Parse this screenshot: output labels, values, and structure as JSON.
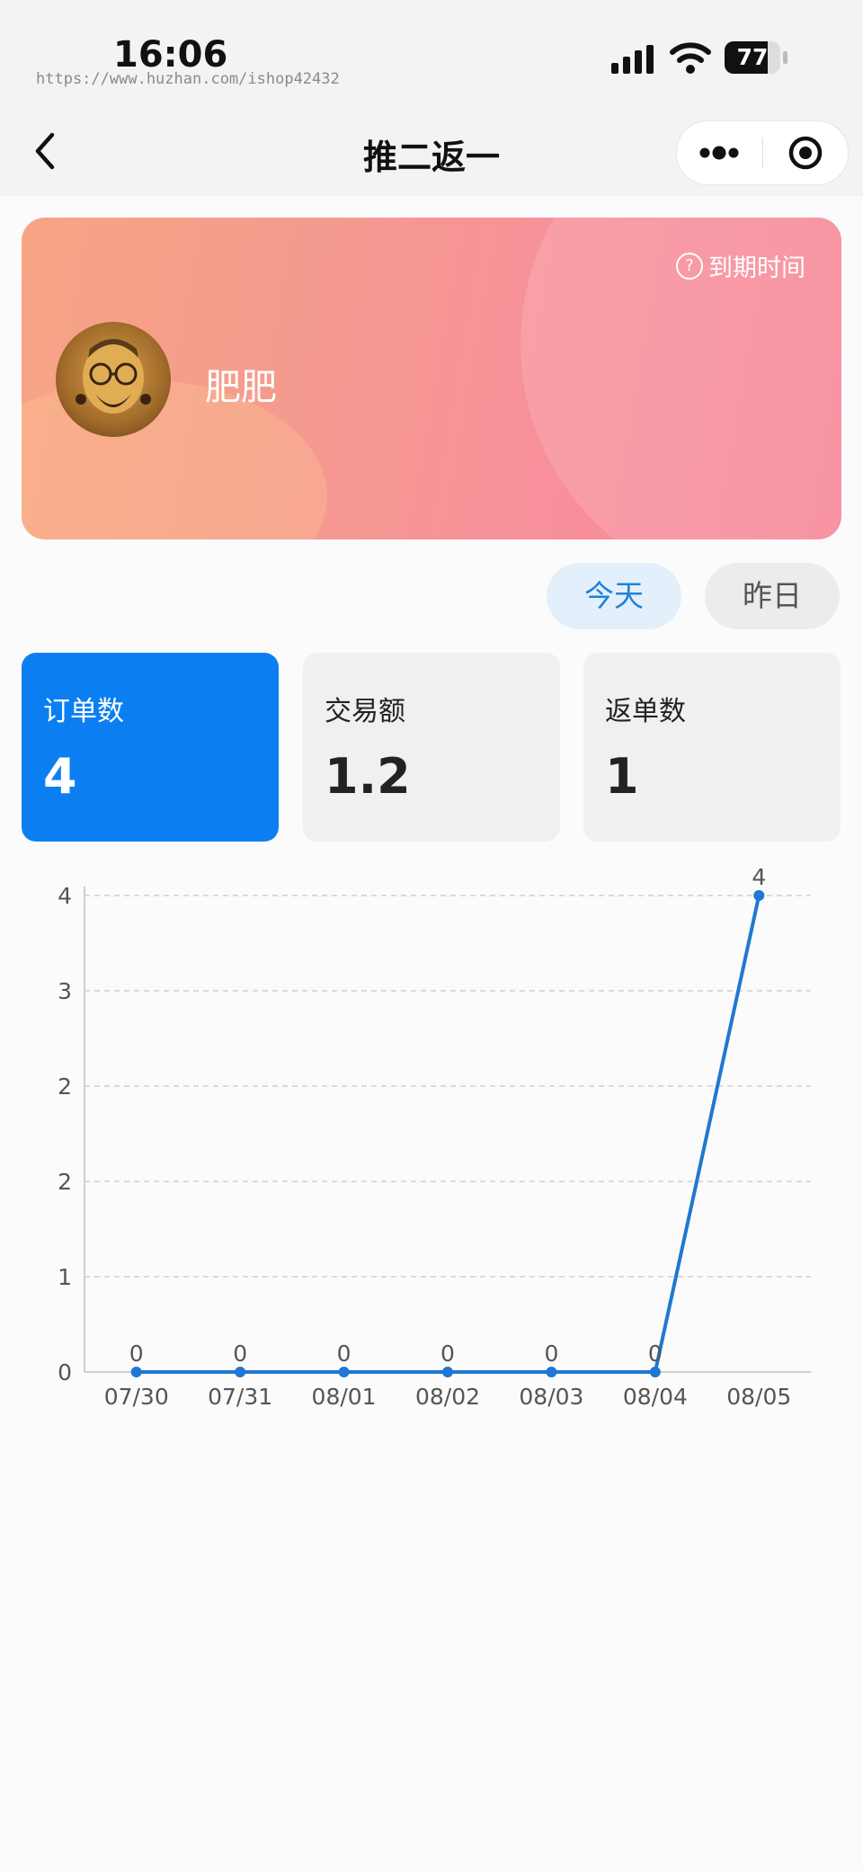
{
  "status_bar": {
    "time": "16:06",
    "watermark": "https://www.huzhan.com/ishop42432",
    "battery_level": "77",
    "battery_fraction": 0.77,
    "icons": [
      "signal-icon",
      "wifi-icon",
      "battery-icon"
    ]
  },
  "nav": {
    "title": "推二返一",
    "icons": [
      "back-icon",
      "more-icon",
      "close-mini-icon"
    ]
  },
  "profile": {
    "expiry_label": "到期时间",
    "user_name": "肥肥",
    "icons": [
      "help-icon",
      "avatar"
    ]
  },
  "date_tabs": [
    {
      "label": "今天",
      "active": true
    },
    {
      "label": "昨日",
      "active": false
    }
  ],
  "stats": [
    {
      "label": "订单数",
      "value": "4",
      "active": true
    },
    {
      "label": "交易额",
      "value": "1.2",
      "active": false
    },
    {
      "label": "返单数",
      "value": "1",
      "active": false
    }
  ],
  "colors": {
    "accent": "#0b7ff2",
    "line": "#1f78d1",
    "tab_active_text": "#1f83d8",
    "tab_active_bg": "#e3f0fb"
  },
  "chart_data": {
    "type": "line",
    "categories": [
      "07/30",
      "07/31",
      "08/01",
      "08/02",
      "08/03",
      "08/04",
      "08/05"
    ],
    "values": [
      0,
      0,
      0,
      0,
      0,
      0,
      4
    ],
    "data_labels": [
      "0",
      "0",
      "0",
      "0",
      "0",
      "0",
      "4"
    ],
    "y_tick_labels": [
      "0",
      "1",
      "2",
      "2",
      "3",
      "4"
    ],
    "ylim": [
      0,
      4
    ],
    "grid": true,
    "title": "",
    "xlabel": "",
    "ylabel": ""
  }
}
